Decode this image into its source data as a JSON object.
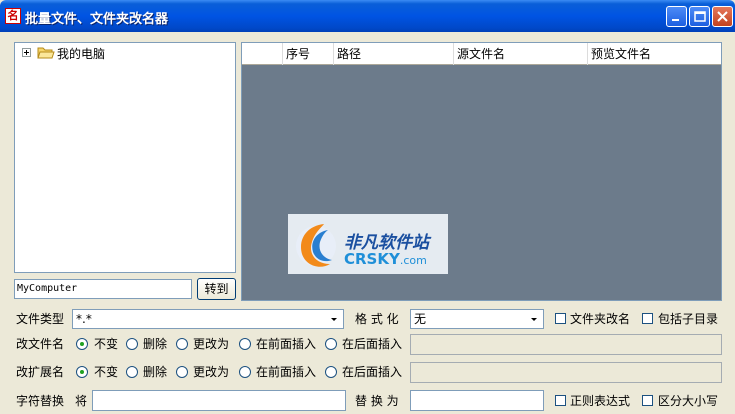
{
  "window": {
    "title": "批量文件、文件夹改名器",
    "app_icon_glyph": "名"
  },
  "tree": {
    "root_label": "我的电脑"
  },
  "path_input": {
    "value": "MyComputer"
  },
  "goto_button": {
    "label": "转到"
  },
  "grid": {
    "columns": [
      "",
      "序号",
      "路径",
      "源文件名",
      "预览文件名"
    ],
    "background": "#6c7b8b"
  },
  "watermark": {
    "cn": "非凡软件站",
    "en_main": "CRSKY",
    "en_suffix": ".com"
  },
  "file_type": {
    "label": "文件类型",
    "value": "*.*"
  },
  "format": {
    "label": "格 式 化",
    "value": "无"
  },
  "options": {
    "rename_folder": "文件夹改名",
    "include_subdirs": "包括子目录",
    "regex": "正则表达式",
    "case_sensitive": "区分大小写"
  },
  "rename_filename": {
    "label": "改文件名",
    "choices": [
      "不变",
      "删除",
      "更改为",
      "在前面插入",
      "在后面插入"
    ],
    "selected": "不变"
  },
  "rename_ext": {
    "label": "改扩展名",
    "choices": [
      "不变",
      "删除",
      "更改为",
      "在前面插入",
      "在后面插入"
    ],
    "selected": "不变"
  },
  "replace": {
    "label": "字符替换",
    "from_label": "将",
    "to_label": "替 换 为"
  }
}
